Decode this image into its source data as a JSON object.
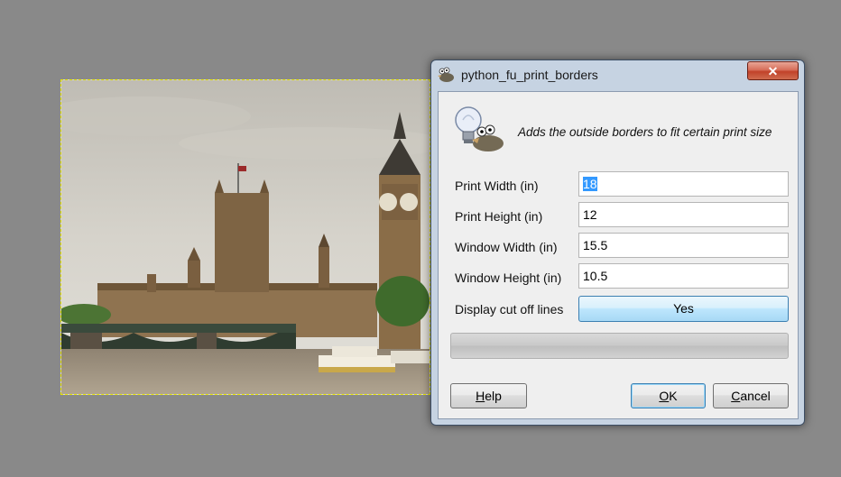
{
  "dialog": {
    "title": "python_fu_print_borders",
    "close_label": "✕",
    "description": "Adds the outside borders to fit certain print size",
    "fields": [
      {
        "label": "Print Width (in)",
        "value": "18",
        "selected": true
      },
      {
        "label": "Print Height (in)",
        "value": "12",
        "selected": false
      },
      {
        "label": "Window Width (in)",
        "value": "15.5",
        "selected": false
      },
      {
        "label": "Window Height (in)",
        "value": "10.5",
        "selected": false
      }
    ],
    "toggle": {
      "label": "Display cut off lines",
      "value": "Yes"
    },
    "buttons": {
      "help": {
        "mnemonic": "H",
        "rest": "elp"
      },
      "ok": {
        "mnemonic": "O",
        "rest": "K"
      },
      "cancel": {
        "mnemonic": "C",
        "rest": "ancel"
      }
    }
  },
  "canvas": {
    "image_subject": "Houses of Parliament and Big Ben beside Westminster Bridge"
  },
  "icons": [
    "gimp-wilber-icon",
    "lightbulb-hint-icon",
    "close-icon"
  ],
  "colors": {
    "workspace_bg": "#898989",
    "selection_border": "#e6e600",
    "titlebar_bg": "#c6d3e2",
    "close_button": "#c1422a",
    "text_selection": "#3399ff",
    "toggle_active": "#bee6fd"
  }
}
